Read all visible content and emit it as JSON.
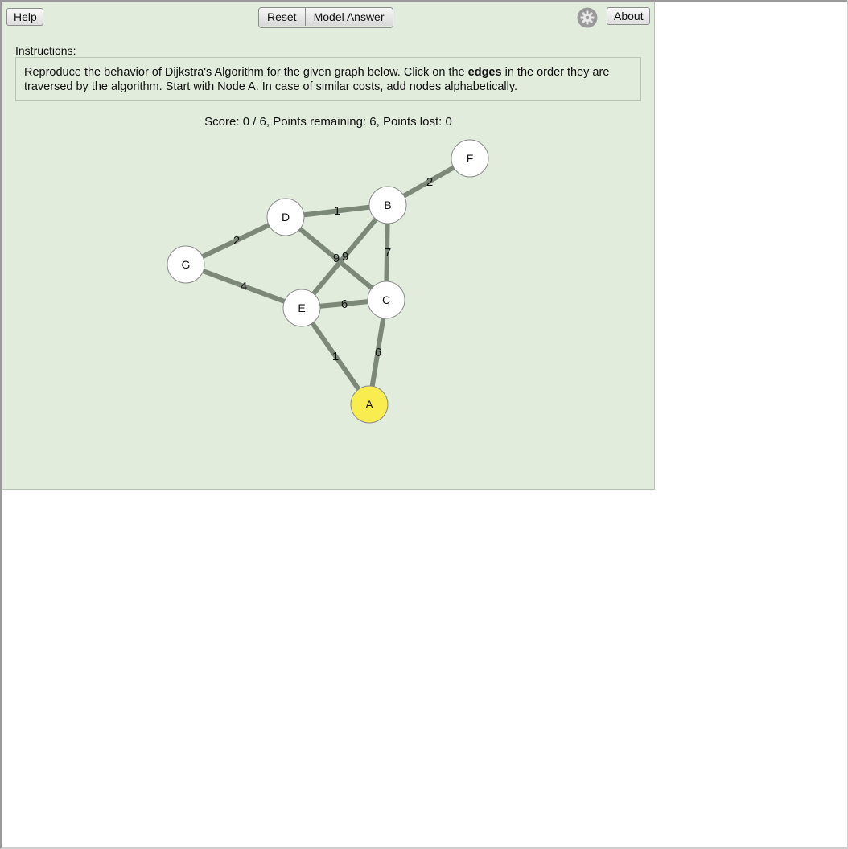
{
  "toolbar": {
    "help_label": "Help",
    "reset_label": "Reset",
    "model_answer_label": "Model Answer",
    "about_label": "About",
    "settings_icon": "gear-icon"
  },
  "instructions": {
    "label": "Instructions:",
    "text_before": "Reproduce the behavior of Dijkstra's Algorithm for the given graph below. Click on the ",
    "text_bold": "edges",
    "text_after": " in the order they are traversed by the algorithm. Start with Node A. In case of similar costs, add nodes alphabetically."
  },
  "score_text": "Score: 0 / 6, Points remaining: 6, Points lost: 0",
  "colors": {
    "background": "#e1ecdd",
    "edge": "#7c8878",
    "node_fill": "#ffffff",
    "start_node_fill": "#f9ec4f"
  },
  "graph": {
    "nodes": [
      {
        "id": "A",
        "label": "A",
        "highlighted": true
      },
      {
        "id": "B",
        "label": "B",
        "highlighted": false
      },
      {
        "id": "C",
        "label": "C",
        "highlighted": false
      },
      {
        "id": "D",
        "label": "D",
        "highlighted": false
      },
      {
        "id": "E",
        "label": "E",
        "highlighted": false
      },
      {
        "id": "F",
        "label": "F",
        "highlighted": false
      },
      {
        "id": "G",
        "label": "G",
        "highlighted": false
      }
    ],
    "edges": [
      {
        "from": "B",
        "to": "F",
        "weight": "2"
      },
      {
        "from": "D",
        "to": "B",
        "weight": "1"
      },
      {
        "from": "G",
        "to": "D",
        "weight": "2"
      },
      {
        "from": "D",
        "to": "C",
        "weight": "9"
      },
      {
        "from": "B",
        "to": "E",
        "weight": "9"
      },
      {
        "from": "B",
        "to": "C",
        "weight": "7"
      },
      {
        "from": "G",
        "to": "E",
        "weight": "4"
      },
      {
        "from": "E",
        "to": "C",
        "weight": "6"
      },
      {
        "from": "E",
        "to": "A",
        "weight": "1"
      },
      {
        "from": "C",
        "to": "A",
        "weight": "6"
      }
    ]
  }
}
